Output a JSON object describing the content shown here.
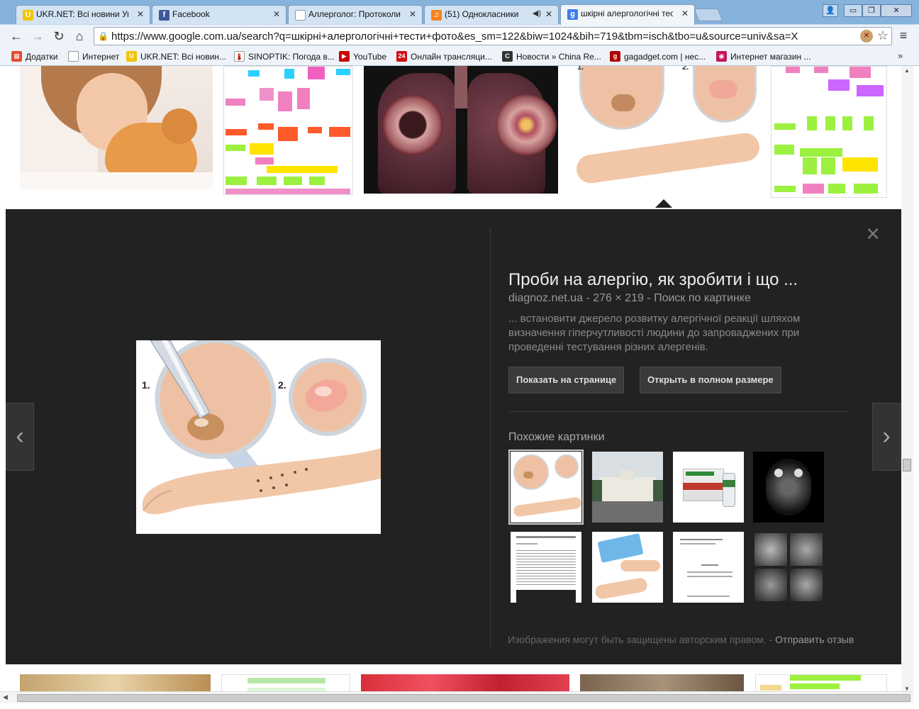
{
  "tabs": [
    {
      "label": "UKR.NET: Всі новини Укр",
      "icon": "ukrnet-icon",
      "color": "#f5c400",
      "glyph": "U"
    },
    {
      "label": "Facebook",
      "icon": "facebook-icon",
      "color": "#3b5998",
      "glyph": "f"
    },
    {
      "label": "Аллерголог: Протоколи",
      "icon": "page-icon",
      "color": "#ffffff",
      "glyph": ""
    },
    {
      "label": "(51) Однокласники",
      "icon": "music-icon",
      "color": "#f58220",
      "glyph": "♫"
    },
    {
      "label": "шкірні алергологічні тес",
      "icon": "google-icon",
      "color": "#3f7de8",
      "glyph": "g"
    }
  ],
  "window_controls": {
    "minimize": "▭",
    "maximize": "❐",
    "close": "✕",
    "user": "👤"
  },
  "address_bar": {
    "url": "https://www.google.com.ua/search?q=шкірні+алергологічні+тести+фото&es_sm=122&biw=1024&bih=719&tbm=isch&tbo=u&source=univ&sa=X"
  },
  "bookmarks": [
    {
      "label": "Додатки",
      "icon": "apps-icon",
      "color": "#e44c2c",
      "glyph": "▦"
    },
    {
      "label": "Интернет",
      "icon": "page-icon",
      "color": "#ffffff",
      "glyph": ""
    },
    {
      "label": "UKR.NET: Всі новин...",
      "icon": "ukrnet-icon",
      "color": "#f5c400",
      "glyph": "U"
    },
    {
      "label": "SINOPTIK: Погода в...",
      "icon": "thermometer-icon",
      "color": "#ffffff",
      "glyph": "🌡"
    },
    {
      "label": "YouTube",
      "icon": "youtube-icon",
      "color": "#cc0000",
      "glyph": "▶"
    },
    {
      "label": "Онлайн трансляци...",
      "icon": "channel24-icon",
      "color": "#d01010",
      "glyph": "24"
    },
    {
      "label": "Новости » China Re...",
      "icon": "china-icon",
      "color": "#333333",
      "glyph": "C"
    },
    {
      "label": "gagadget.com | нес...",
      "icon": "gagadget-icon",
      "color": "#b00000",
      "glyph": "g"
    },
    {
      "label": "Интернет магазин ...",
      "icon": "shop-icon",
      "color": "#c2185b",
      "glyph": "◉"
    }
  ],
  "bookmarks_more": "»",
  "preview": {
    "title": "Проби на алергію, як зробити і що ...",
    "source": "diagnoz.net.ua",
    "size": "276 × 219",
    "search_link": "Поиск по картинке",
    "separator": "-",
    "description": "... встановити джерело розвитку алергічної реакції шляхом визначення гіперчутливості людини до запроваджених при проведенні тестування різних алергенів.",
    "btn_show": "Показать на странице",
    "btn_open": "Открыть в полном размере",
    "similar_label": "Похожие картинки",
    "image_labels": {
      "step1": "1.",
      "step2": "2."
    },
    "copyright": "Изображения могут быть защищены авторским правом.",
    "feedback": "Отправить отзыв"
  },
  "icons": {
    "back": "←",
    "forward": "→",
    "reload": "↻",
    "home": "⌂",
    "star": "☆",
    "menu": "≡",
    "close": "×",
    "prev": "‹",
    "next": "›"
  }
}
